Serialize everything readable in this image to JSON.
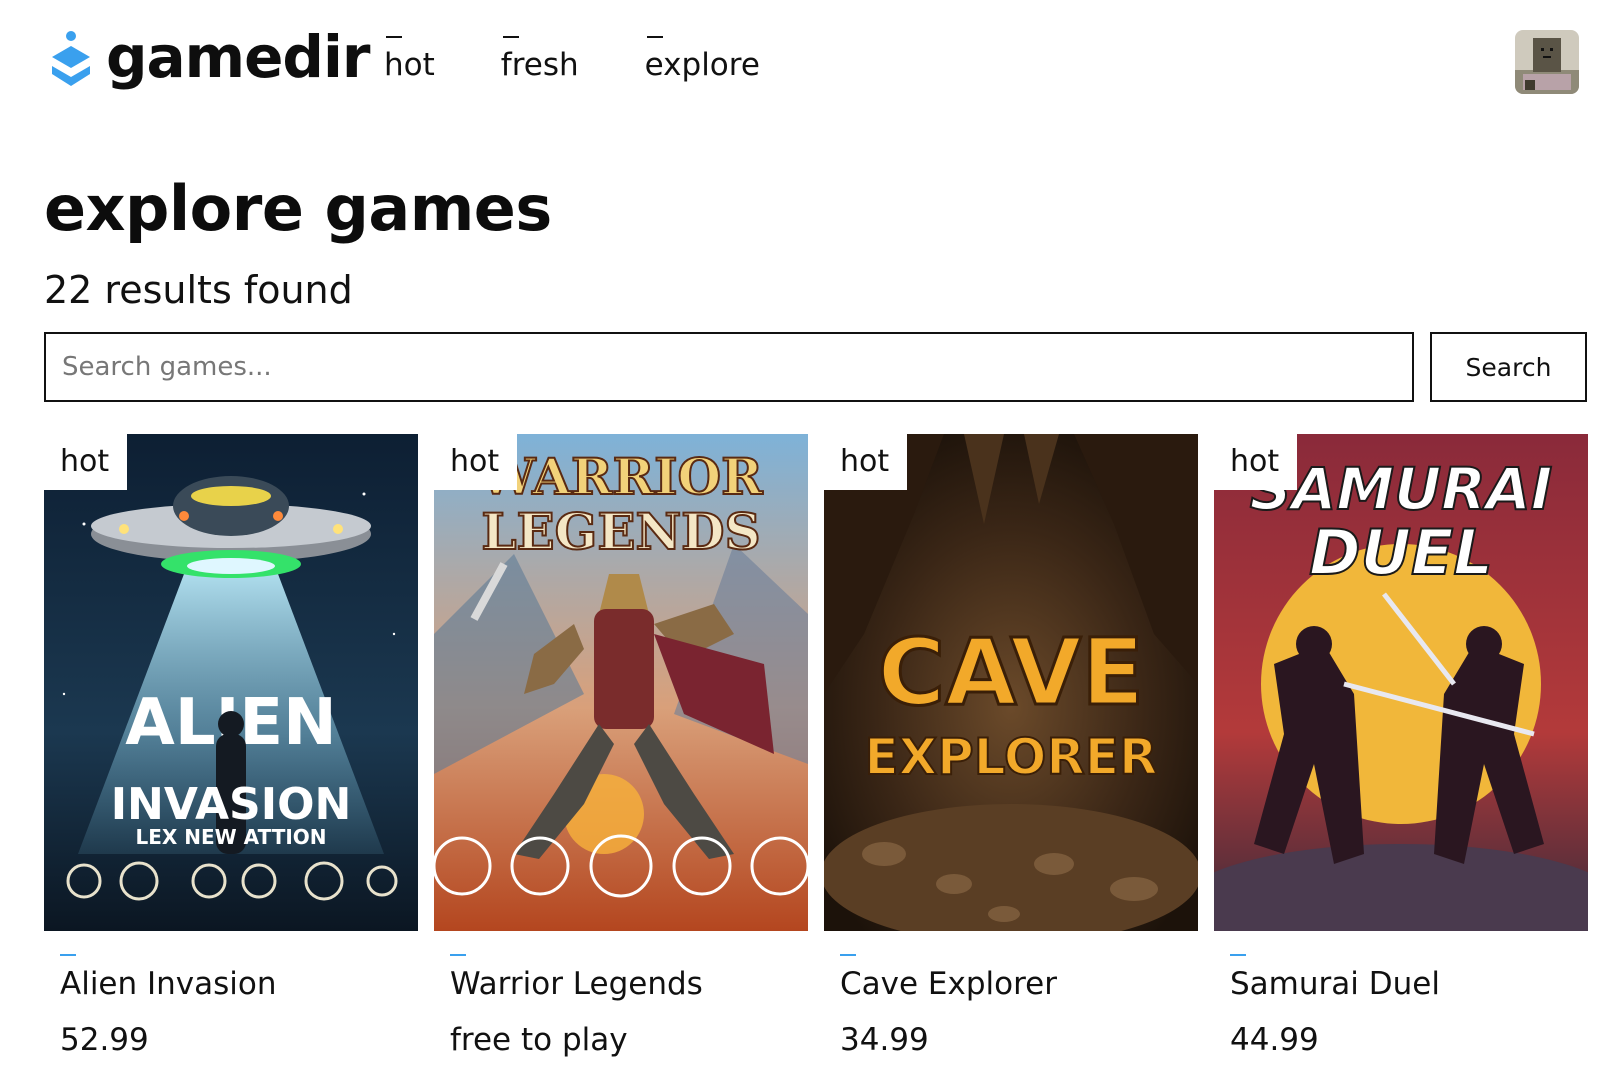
{
  "brand": {
    "name": "gamedir",
    "accent_color": "#3aa0ee"
  },
  "nav": {
    "items": [
      {
        "label": "hot"
      },
      {
        "label": "fresh"
      },
      {
        "label": "explore"
      }
    ]
  },
  "page": {
    "title": "explore games",
    "results_text": "22 results found"
  },
  "search": {
    "placeholder": "Search games...",
    "value": "",
    "button_label": "Search"
  },
  "games": [
    {
      "badge": "hot",
      "title": "Alien Invasion",
      "price": "52.99",
      "cover_line1": "ALIEN",
      "cover_line2": "INVASION",
      "cover_line3": "LEX NEW ATTION"
    },
    {
      "badge": "hot",
      "title": "Warrior Legends",
      "price": "free to play",
      "cover_line1": "WARRIOR",
      "cover_line2": "LEGENDS"
    },
    {
      "badge": "hot",
      "title": "Cave Explorer",
      "price": "34.99",
      "cover_line1": "CAVE",
      "cover_line2": "EXPLORER"
    },
    {
      "badge": "hot",
      "title": "Samurai Duel",
      "price": "44.99",
      "cover_line1": "SAMURAI",
      "cover_line2": "DUEL"
    }
  ]
}
